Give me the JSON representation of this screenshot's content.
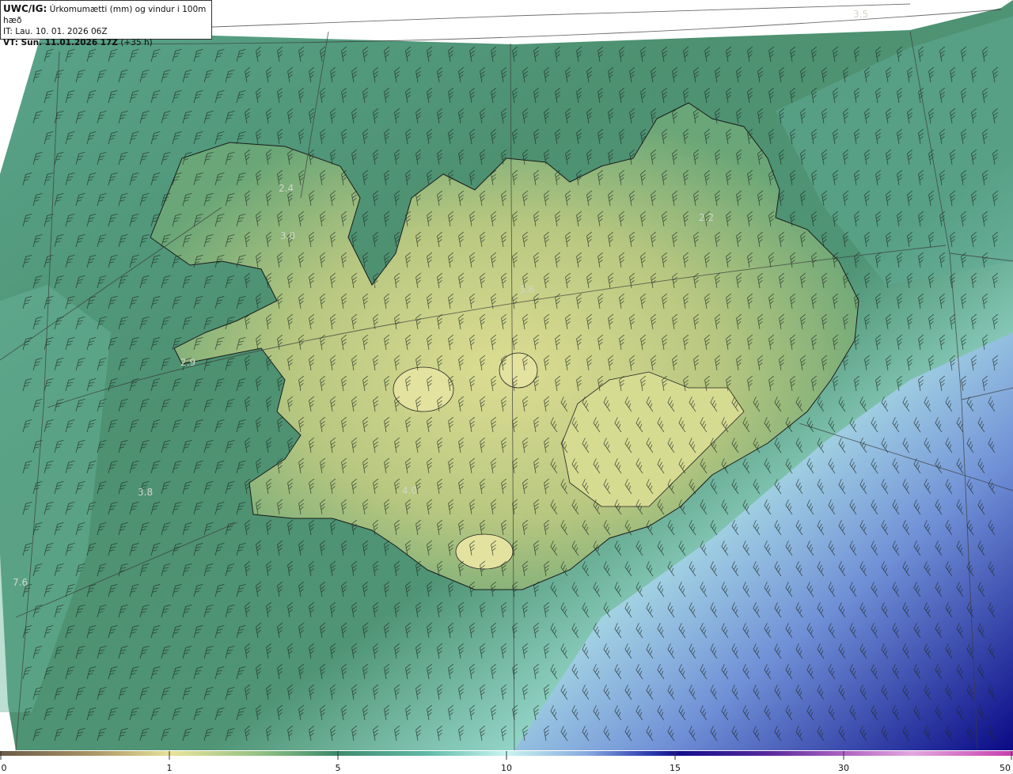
{
  "header": {
    "model": "UWC/IG:",
    "title": "Úrkomumætti (mm) og vindur i 100m hæð",
    "it_prefix": "IT: Lau. 10. 01. 2026 06Z",
    "vt_prefix": "VT: Sun. 11.01.2026 17Z",
    "vt_offset": "(+35 h)"
  },
  "map": {
    "region": "Iceland",
    "isolines": [
      {
        "label": "3.5"
      },
      {
        "label": "2.4"
      },
      {
        "label": "3.0"
      },
      {
        "label": "2.2"
      },
      {
        "label": "2.9"
      },
      {
        "label": "3.8"
      },
      {
        "label": "4.0"
      },
      {
        "label": "7.6"
      },
      {
        "label": "3.6"
      }
    ],
    "colors": {
      "land_high": "#d9dc8c",
      "land_mid": "#9fb977",
      "sea_green": "#4d9171",
      "sea_teal": "#5aa58d",
      "light_cyan": "#c4f0ea",
      "blue": "#3a55b8",
      "dark_blue": "#0b0f8a",
      "coast": "#1a1a1a"
    }
  },
  "colorbar": {
    "ticks": [
      "0",
      "1",
      "5",
      "10",
      "15",
      "30",
      "50"
    ],
    "colors": [
      "#6b5a47",
      "#a89466",
      "#e8e39a",
      "#8fbf83",
      "#3e8a6b",
      "#7fd0c4",
      "#c8f5f0",
      "#87a9df",
      "#2e3fb0",
      "#120f8c",
      "#5a2a9c",
      "#b569c4",
      "#e2a7de",
      "#c83fae"
    ]
  }
}
